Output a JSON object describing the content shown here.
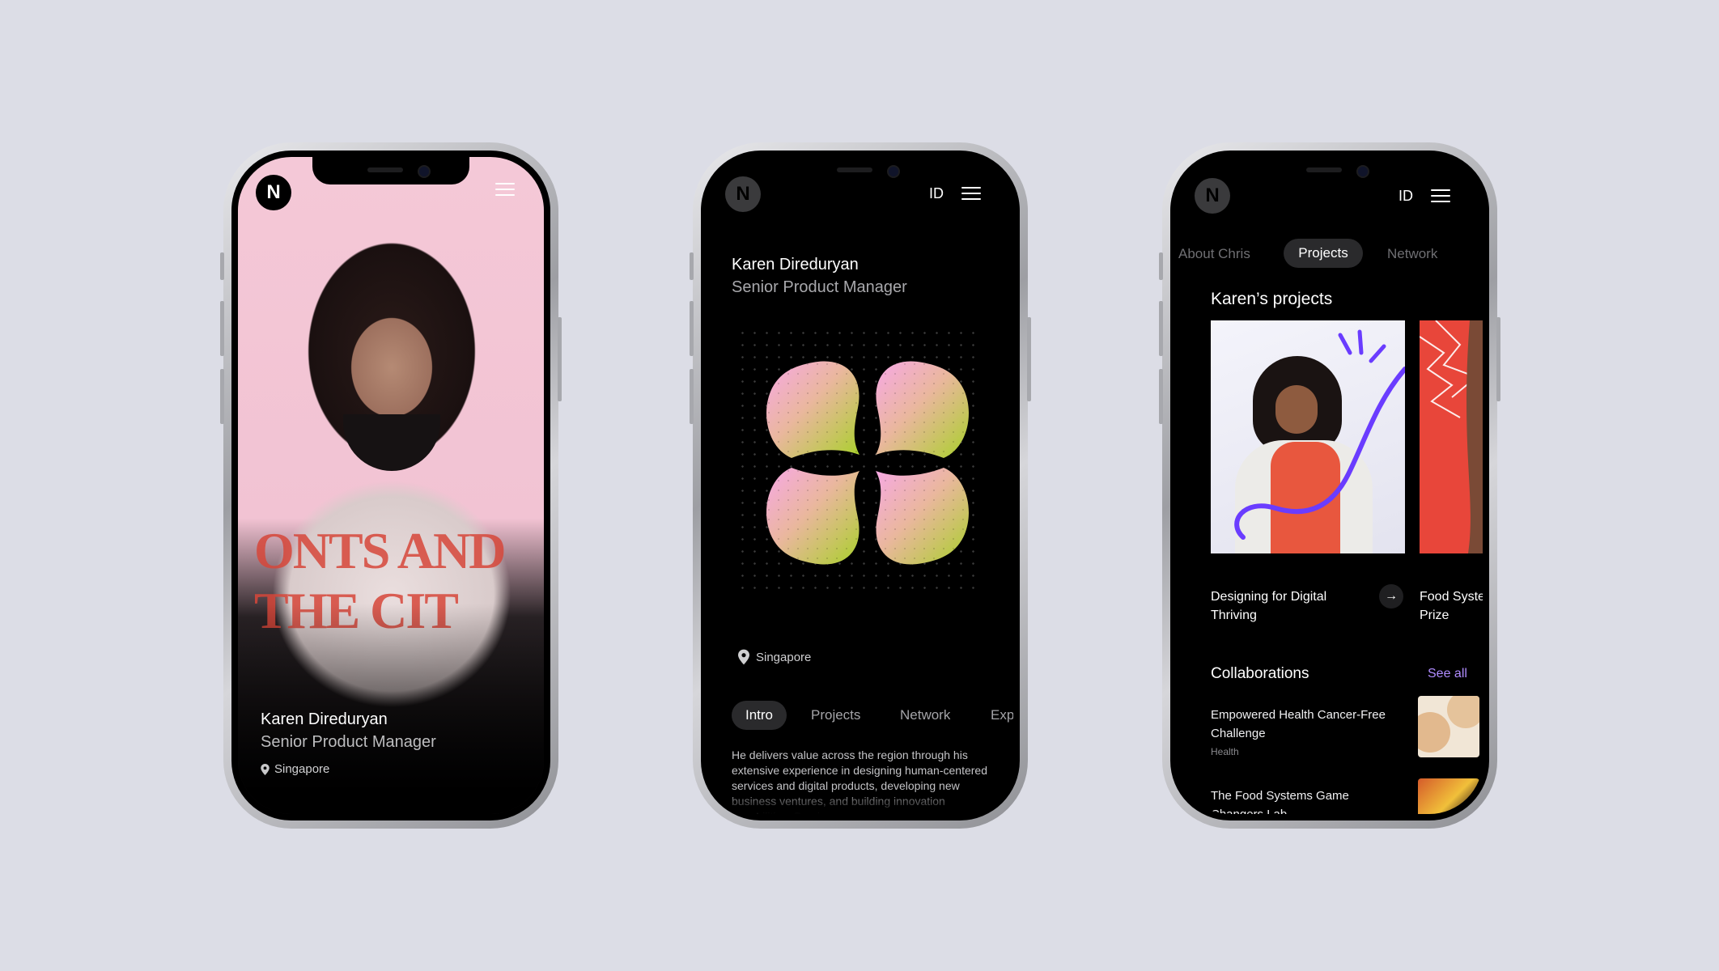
{
  "brand": {
    "logo_letter": "N",
    "accent": "#b08cff"
  },
  "phone1": {
    "name": "Karen Direduryan",
    "role": "Senior Product Manager",
    "location": "Singapore",
    "shirt_text": "ONTS AND THE CIT"
  },
  "phone2": {
    "lang": "ID",
    "name": "Karen Direduryan",
    "role": "Senior Product Manager",
    "location": "Singapore",
    "tabs": [
      "Intro",
      "Projects",
      "Network",
      "Exp"
    ],
    "active_tab": "Intro",
    "intro_text": "He delivers value across the region through his extensive experience in designing human-centered services and digital products, developing new business ventures, and building innovation capabilities. Bea is"
  },
  "phone3": {
    "lang": "ID",
    "tabs": [
      "About Chris",
      "Projects",
      "Network"
    ],
    "active_tab": "Projects",
    "projects_title": "Karen’s projects",
    "projects": [
      {
        "title": "Designing for Digital Thriving"
      },
      {
        "title": "Food Systems Vision Prize"
      }
    ],
    "collab_title": "Collaborations",
    "see_all": "See all",
    "collaborations": [
      {
        "title": "Empowered Health Cancer-Free Challenge",
        "tag": "Health"
      },
      {
        "title": "The Food Systems Game Changers Lab",
        "tag": ""
      }
    ]
  }
}
